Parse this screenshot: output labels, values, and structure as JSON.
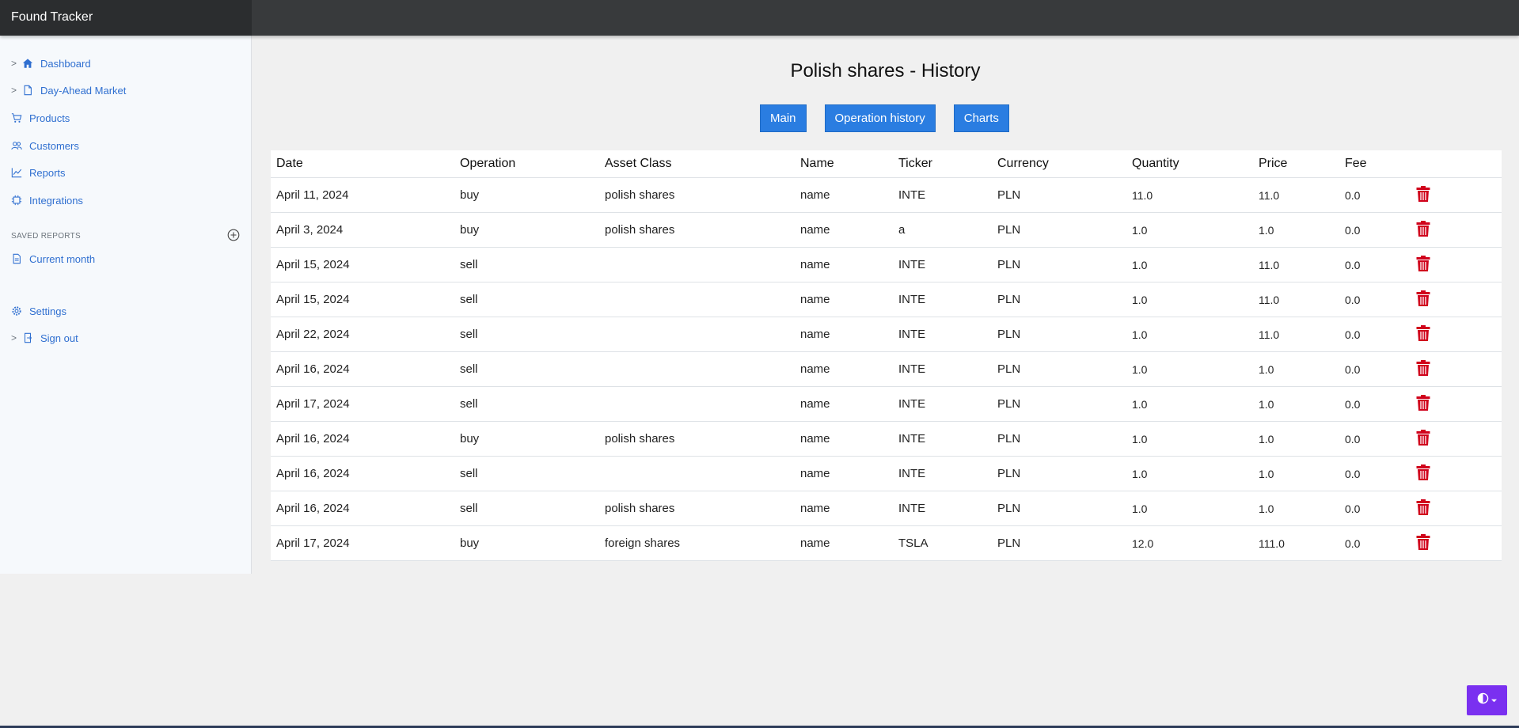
{
  "app": {
    "title": "Found Tracker"
  },
  "sidebar": {
    "items": [
      {
        "label": "Dashboard",
        "icon": "home-icon",
        "caret": ">"
      },
      {
        "label": "Day-Ahead Market",
        "icon": "file-icon",
        "caret": ">"
      },
      {
        "label": "Products",
        "icon": "cart-icon"
      },
      {
        "label": "Customers",
        "icon": "users-icon"
      },
      {
        "label": "Reports",
        "icon": "line-chart-icon"
      },
      {
        "label": "Integrations",
        "icon": "chip-icon"
      }
    ],
    "saved_reports_title": "SAVED REPORTS",
    "saved_reports": [
      {
        "label": "Current month",
        "icon": "file-text-icon"
      }
    ],
    "bottom_items": [
      {
        "label": "Settings",
        "icon": "gear-icon"
      },
      {
        "label": "Sign out",
        "icon": "sign-out-icon",
        "caret": ">"
      }
    ]
  },
  "main": {
    "title": "Polish shares - History",
    "buttons": {
      "main": "Main",
      "operation_history": "Operation history",
      "charts": "Charts"
    },
    "table": {
      "headers": [
        "Date",
        "Operation",
        "Asset Class",
        "Name",
        "Ticker",
        "Currency",
        "Quantity",
        "Price",
        "Fee"
      ],
      "rows": [
        [
          "April 11, 2024",
          "buy",
          "polish shares",
          "name",
          "INTE",
          "PLN",
          "11.0",
          "11.0",
          "0.0"
        ],
        [
          "April 3, 2024",
          "buy",
          "polish shares",
          "name",
          "a",
          "PLN",
          "1.0",
          "1.0",
          "0.0"
        ],
        [
          "April 15, 2024",
          "sell",
          "",
          "name",
          "INTE",
          "PLN",
          "1.0",
          "11.0",
          "0.0"
        ],
        [
          "April 15, 2024",
          "sell",
          "",
          "name",
          "INTE",
          "PLN",
          "1.0",
          "11.0",
          "0.0"
        ],
        [
          "April 22, 2024",
          "sell",
          "",
          "name",
          "INTE",
          "PLN",
          "1.0",
          "11.0",
          "0.0"
        ],
        [
          "April 16, 2024",
          "sell",
          "",
          "name",
          "INTE",
          "PLN",
          "1.0",
          "1.0",
          "0.0"
        ],
        [
          "April 17, 2024",
          "sell",
          "",
          "name",
          "INTE",
          "PLN",
          "1.0",
          "1.0",
          "0.0"
        ],
        [
          "April 16, 2024",
          "buy",
          "polish shares",
          "name",
          "INTE",
          "PLN",
          "1.0",
          "1.0",
          "0.0"
        ],
        [
          "April 16, 2024",
          "sell",
          "",
          "name",
          "INTE",
          "PLN",
          "1.0",
          "1.0",
          "0.0"
        ],
        [
          "April 16, 2024",
          "sell",
          "polish shares",
          "name",
          "INTE",
          "PLN",
          "1.0",
          "1.0",
          "0.0"
        ],
        [
          "April 17, 2024",
          "buy",
          "foreign shares",
          "name",
          "TSLA",
          "PLN",
          "12.0",
          "111.0",
          "0.0"
        ]
      ]
    }
  },
  "colors": {
    "accent": "#2a7de1",
    "delete": "#d0021b",
    "theme_toggle": "#7a30f0",
    "link": "#2f6fd0"
  }
}
